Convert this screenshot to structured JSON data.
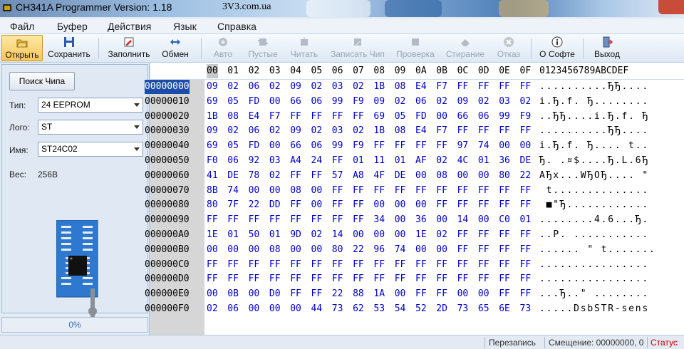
{
  "window": {
    "title": "CH341A Programmer Version: 1.18",
    "site": "3V3.com.ua"
  },
  "menu": [
    "Файл",
    "Буфер",
    "Действия",
    "Язык",
    "Справка"
  ],
  "toolbar": {
    "open": "Открыть",
    "save": "Сохранить",
    "fill": "Заполнить",
    "swap": "Обмен",
    "auto": "Авто",
    "blank": "Пустые",
    "read": "Читать",
    "write": "Записать Чип",
    "verify": "Проверка",
    "erase": "Стирание",
    "cancel": "Отказ",
    "about": "О Софте",
    "exit": "Выход"
  },
  "left": {
    "search_button": "Поиск Чипа",
    "type_label": "Тип:",
    "type_value": "24 EEPROM",
    "vendor_label": "Лого:",
    "vendor_value": "ST",
    "name_label": "Имя:",
    "name_value": "ST24C02",
    "size_label": "Вес:",
    "size_value": "256B",
    "progress_percent": 0,
    "progress_text": "0%"
  },
  "hex": {
    "columns": [
      "00",
      "01",
      "02",
      "03",
      "04",
      "05",
      "06",
      "07",
      "08",
      "09",
      "0A",
      "0B",
      "0C",
      "0D",
      "0E",
      "0F"
    ],
    "ascii_header": "0123456789ABCDEF",
    "rows": [
      {
        "addr": "00000000",
        "bytes": [
          "09",
          "02",
          "06",
          "02",
          "09",
          "02",
          "03",
          "02",
          "1B",
          "08",
          "E4",
          "F7",
          "FF",
          "FF",
          "FF",
          "FF"
        ],
        "ascii": "..........ЂЂ...."
      },
      {
        "addr": "00000010",
        "bytes": [
          "69",
          "05",
          "FD",
          "00",
          "66",
          "06",
          "99",
          "F9",
          "09",
          "02",
          "06",
          "02",
          "09",
          "02",
          "03",
          "02"
        ],
        "ascii": "i.Ђ.f. Ђ........"
      },
      {
        "addr": "00000020",
        "bytes": [
          "1B",
          "08",
          "E4",
          "F7",
          "FF",
          "FF",
          "FF",
          "FF",
          "69",
          "05",
          "FD",
          "00",
          "66",
          "06",
          "99",
          "F9"
        ],
        "ascii": "..ЂЂ....i.Ђ.f. Ђ"
      },
      {
        "addr": "00000030",
        "bytes": [
          "09",
          "02",
          "06",
          "02",
          "09",
          "02",
          "03",
          "02",
          "1B",
          "08",
          "E4",
          "F7",
          "FF",
          "FF",
          "FF",
          "FF"
        ],
        "ascii": "..........ЂЂ...."
      },
      {
        "addr": "00000040",
        "bytes": [
          "69",
          "05",
          "FD",
          "00",
          "66",
          "06",
          "99",
          "F9",
          "FF",
          "FF",
          "FF",
          "FF",
          "97",
          "74",
          "00",
          "00"
        ],
        "ascii": "i.Ђ.f. Ђ.... t.."
      },
      {
        "addr": "00000050",
        "bytes": [
          "F0",
          "06",
          "92",
          "03",
          "A4",
          "24",
          "FF",
          "01",
          "11",
          "01",
          "AF",
          "02",
          "4C",
          "01",
          "36",
          "DE"
        ],
        "ascii": "Ђ. .¤$....Ђ.L.6Ђ"
      },
      {
        "addr": "00000060",
        "bytes": [
          "41",
          "DE",
          "78",
          "02",
          "FF",
          "FF",
          "57",
          "A8",
          "4F",
          "DE",
          "00",
          "08",
          "00",
          "00",
          "80",
          "22"
        ],
        "ascii": "AЂx...WЂOЂ.... \""
      },
      {
        "addr": "00000070",
        "bytes": [
          "8B",
          "74",
          "00",
          "00",
          "08",
          "00",
          "FF",
          "FF",
          "FF",
          "FF",
          "FF",
          "FF",
          "FF",
          "FF",
          "FF",
          "FF"
        ],
        "ascii": " t.............."
      },
      {
        "addr": "00000080",
        "bytes": [
          "80",
          "7F",
          "22",
          "DD",
          "FF",
          "00",
          "FF",
          "FF",
          "00",
          "00",
          "00",
          "FF",
          "FF",
          "FF",
          "FF",
          "FF"
        ],
        "ascii": " ■\"Ђ............"
      },
      {
        "addr": "00000090",
        "bytes": [
          "FF",
          "FF",
          "FF",
          "FF",
          "FF",
          "FF",
          "FF",
          "FF",
          "34",
          "00",
          "36",
          "00",
          "14",
          "00",
          "C0",
          "01"
        ],
        "ascii": "........4.6...Ђ."
      },
      {
        "addr": "000000A0",
        "bytes": [
          "1E",
          "01",
          "50",
          "01",
          "9D",
          "02",
          "14",
          "00",
          "00",
          "00",
          "1E",
          "02",
          "FF",
          "FF",
          "FF",
          "FF"
        ],
        "ascii": "..P. ..........."
      },
      {
        "addr": "000000B0",
        "bytes": [
          "00",
          "00",
          "00",
          "08",
          "00",
          "00",
          "80",
          "22",
          "96",
          "74",
          "00",
          "00",
          "FF",
          "FF",
          "FF",
          "FF"
        ],
        "ascii": "...... \" t......."
      },
      {
        "addr": "000000C0",
        "bytes": [
          "FF",
          "FF",
          "FF",
          "FF",
          "FF",
          "FF",
          "FF",
          "FF",
          "FF",
          "FF",
          "FF",
          "FF",
          "FF",
          "FF",
          "FF",
          "FF"
        ],
        "ascii": "................"
      },
      {
        "addr": "000000D0",
        "bytes": [
          "FF",
          "FF",
          "FF",
          "FF",
          "FF",
          "FF",
          "FF",
          "FF",
          "FF",
          "FF",
          "FF",
          "FF",
          "FF",
          "FF",
          "FF",
          "FF"
        ],
        "ascii": "................"
      },
      {
        "addr": "000000E0",
        "bytes": [
          "00",
          "0B",
          "00",
          "D0",
          "FF",
          "FF",
          "22",
          "88",
          "1A",
          "00",
          "FF",
          "FF",
          "00",
          "00",
          "FF",
          "FF"
        ],
        "ascii": "...Ђ..\" ........"
      },
      {
        "addr": "000000F0",
        "bytes": [
          "02",
          "06",
          "00",
          "00",
          "00",
          "44",
          "73",
          "62",
          "53",
          "54",
          "52",
          "2D",
          "73",
          "65",
          "6E",
          "73"
        ],
        "ascii": ".....DsbSTR-sens"
      }
    ]
  },
  "status": {
    "mode": "Перезапись",
    "offset": "Смещение: 00000000, 0",
    "state": "Статус"
  },
  "colors": {
    "accent": "#1c4da8",
    "hex_text": "#0000c8",
    "status_red": "#cc0000"
  }
}
